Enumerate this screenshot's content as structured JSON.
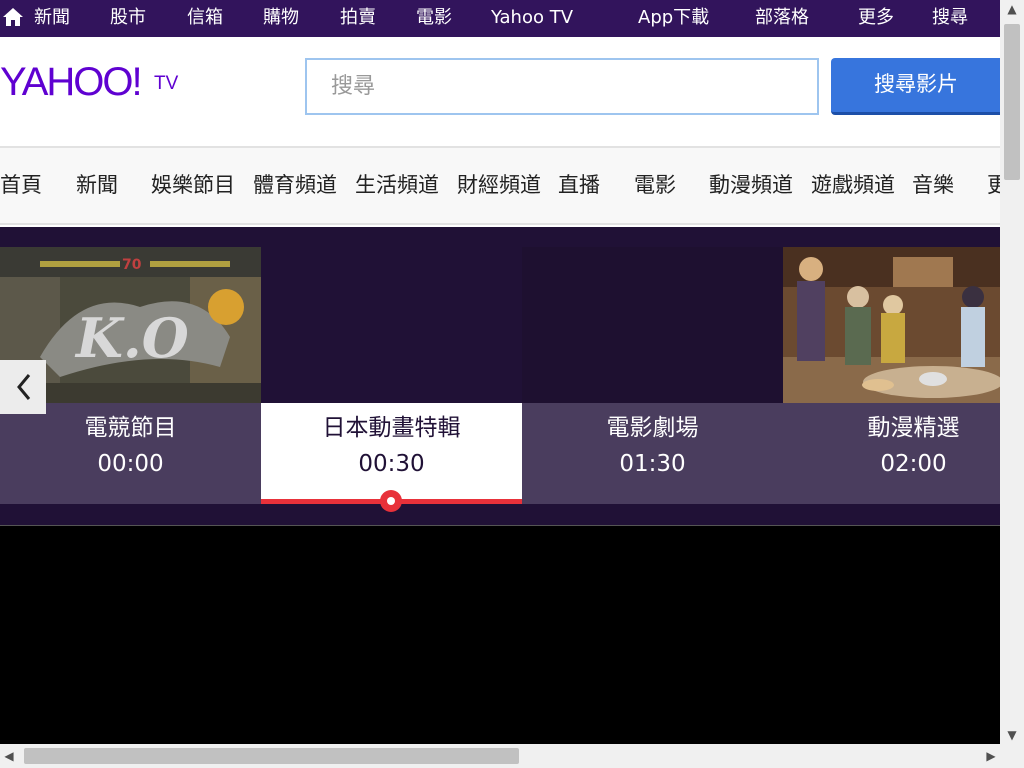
{
  "topnav": {
    "items": [
      "新聞",
      "股市",
      "信箱",
      "購物",
      "拍賣",
      "電影",
      "Yahoo TV",
      "App下載",
      "部落格",
      "更多",
      "搜尋"
    ]
  },
  "header": {
    "logo_main": "YAHOO!",
    "logo_sub": "TV",
    "search_placeholder": "搜尋",
    "search_button": "搜尋影片"
  },
  "categories": [
    "首頁",
    "新聞",
    "娛樂節目",
    "體育頻道",
    "生活頻道",
    "財經頻道",
    "直播",
    "電影",
    "動漫頻道",
    "遊戲頻道",
    "音樂",
    "更"
  ],
  "schedule": {
    "items": [
      {
        "title": "電競節目",
        "time": "00:00",
        "active": false
      },
      {
        "title": "日本動畫特輯",
        "time": "00:30",
        "active": true,
        "progress": 0.5
      },
      {
        "title": "電影劇場",
        "time": "01:30",
        "active": false
      },
      {
        "title": "動漫精選",
        "time": "02:00",
        "active": false
      }
    ]
  },
  "colors": {
    "topnav_bg": "#32145c",
    "brand_purple": "#5f01d1",
    "search_button": "#3775dd",
    "schedule_bg": "#201136",
    "card_info": "#4a3d5e",
    "progress": "#e8313a"
  }
}
